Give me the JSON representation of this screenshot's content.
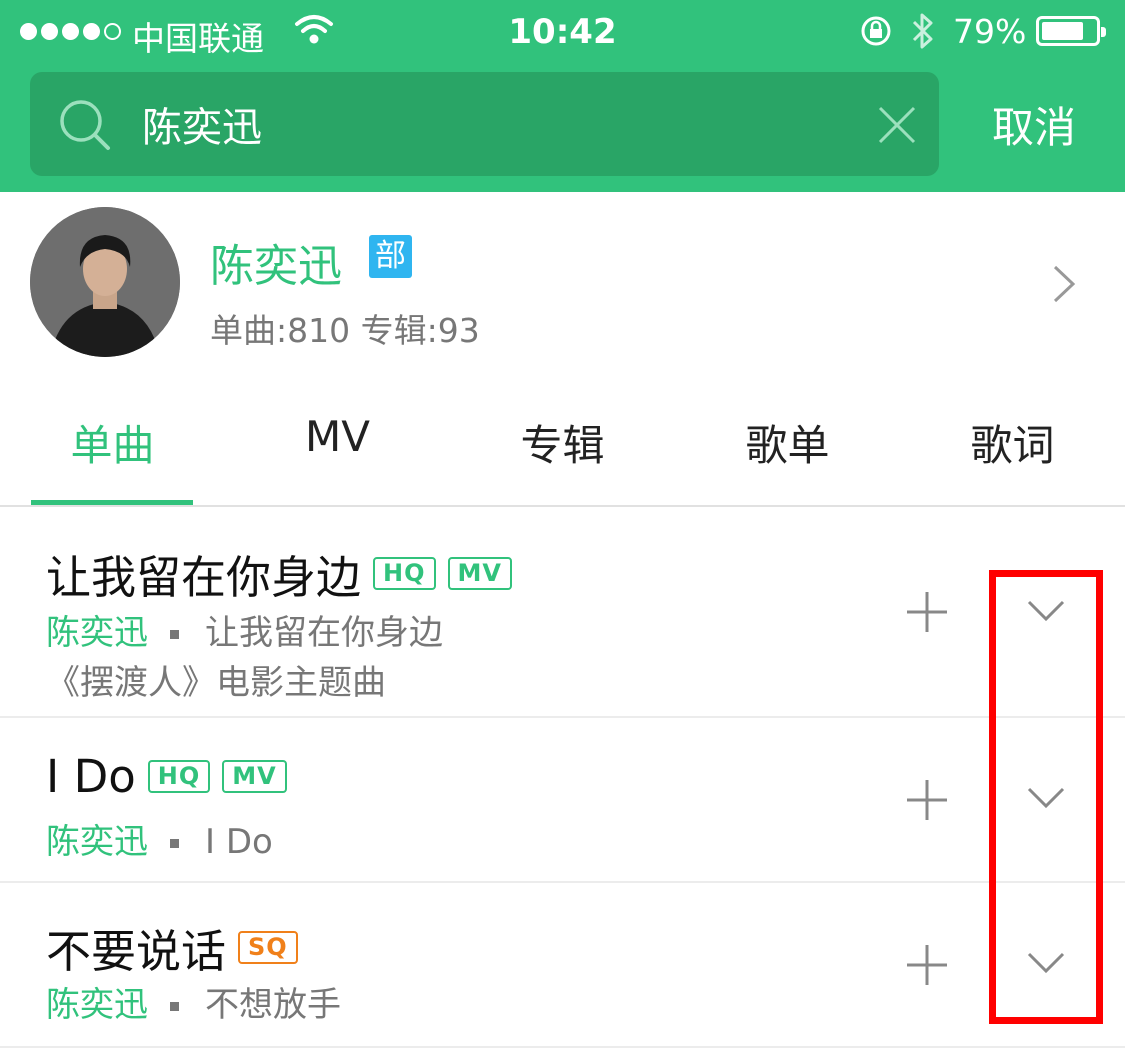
{
  "status_bar": {
    "carrier": "中国联通",
    "time": "10:42",
    "battery_percent": "79%",
    "battery_level": 0.79
  },
  "search": {
    "query": "陈奕迅",
    "cancel_label": "取消"
  },
  "artist": {
    "name": "陈奕迅",
    "badge": "部",
    "stats": "单曲:810 专辑:93"
  },
  "tabs": [
    {
      "label": "单曲",
      "active": true
    },
    {
      "label": "MV",
      "active": false
    },
    {
      "label": "专辑",
      "active": false
    },
    {
      "label": "歌单",
      "active": false
    },
    {
      "label": "歌词",
      "active": false
    }
  ],
  "songs": [
    {
      "title": "让我留在你身边",
      "tags": [
        "HQ",
        "MV"
      ],
      "artist": "陈奕迅",
      "album": "让我留在你身边",
      "description": "《摆渡人》电影主题曲"
    },
    {
      "title": "I Do",
      "tags": [
        "HQ",
        "MV"
      ],
      "artist": "陈奕迅",
      "album": "I Do"
    },
    {
      "title": "不要说话",
      "tags": [
        "SQ"
      ],
      "artist": "陈奕迅",
      "album": "不想放手"
    }
  ],
  "colors": {
    "brand_green": "#31c27c",
    "search_bg": "#29a566",
    "sq_orange": "#f0801a",
    "badge_blue": "#2fb5f0",
    "highlight_red": "#ff0000"
  },
  "icons": [
    "signal-dots-icon",
    "wifi-icon",
    "rotation-lock-icon",
    "bluetooth-icon",
    "battery-icon",
    "search-icon",
    "clear-icon",
    "chevron-right-icon",
    "plus-icon",
    "chevron-down-icon"
  ]
}
